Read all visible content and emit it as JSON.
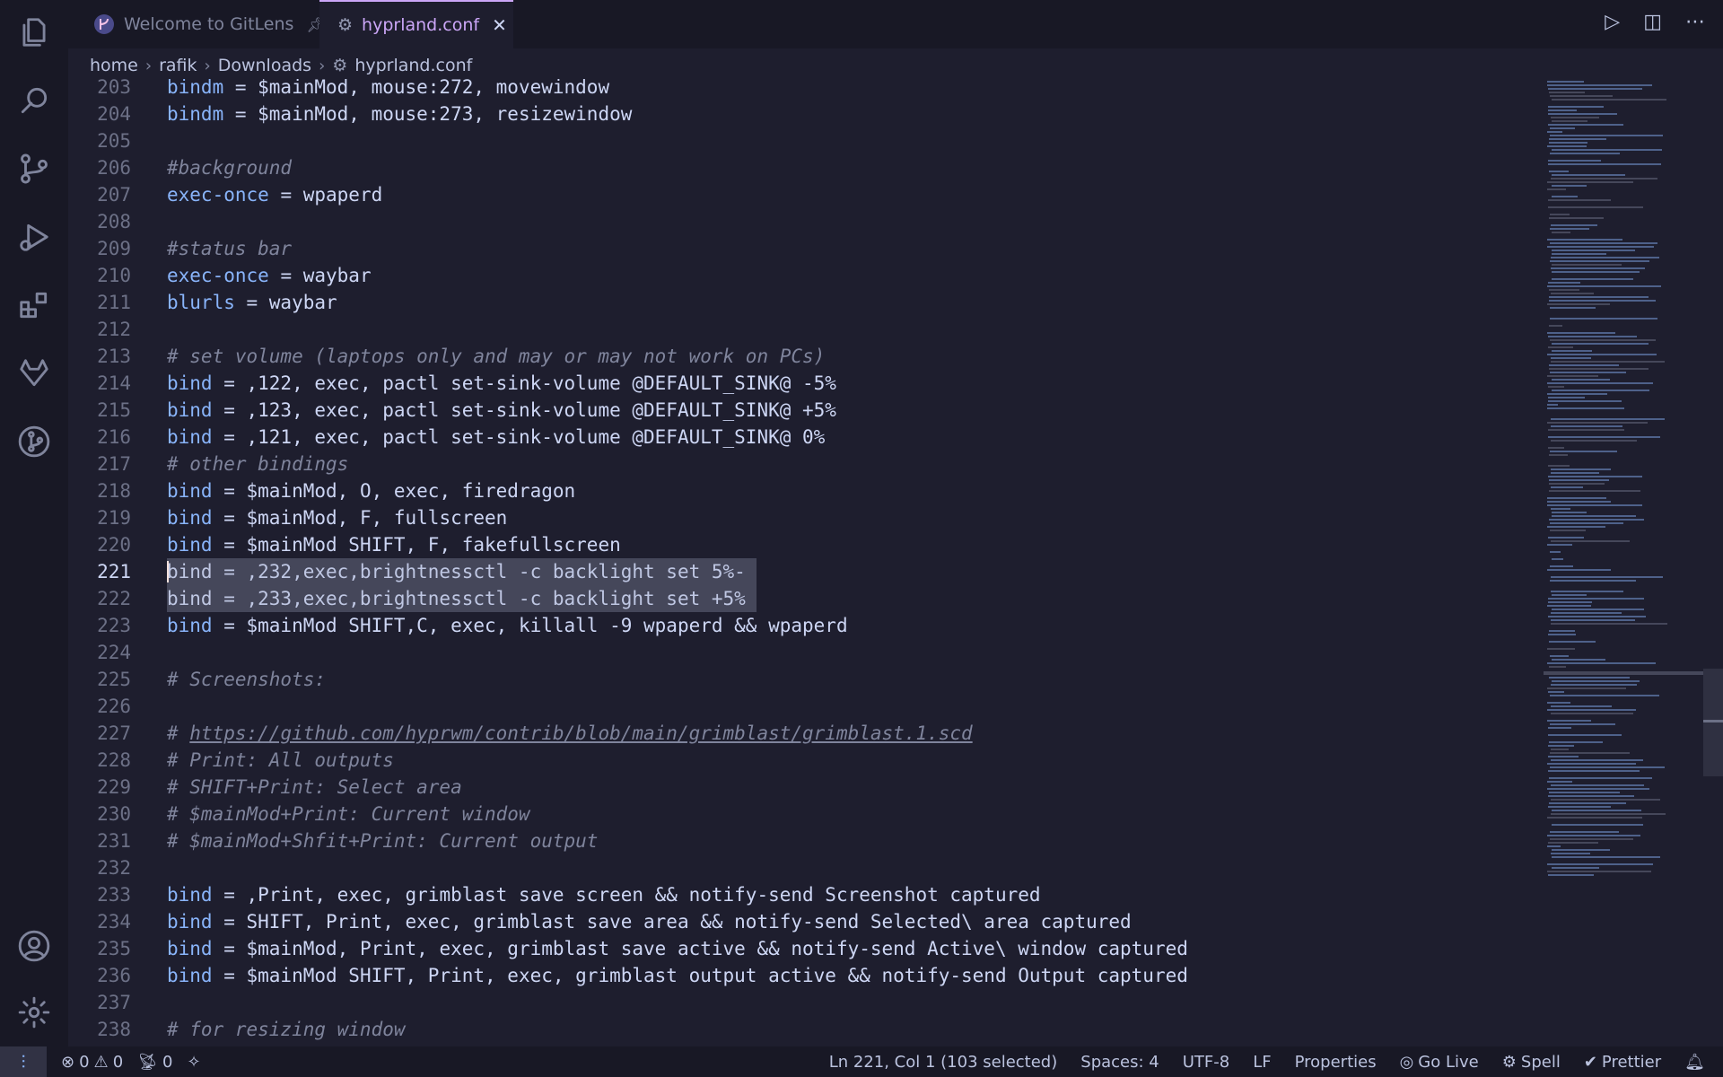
{
  "tabs": [
    {
      "label": "Welcome to GitLens",
      "icon": "gitlens-icon",
      "pinned": true
    },
    {
      "label": "hyprland.conf",
      "icon": "gear-icon",
      "active": true
    }
  ],
  "breadcrumb": [
    "home",
    "rafik",
    "Downloads",
    "hyprland.conf"
  ],
  "editor": {
    "lines": [
      {
        "n": "203",
        "parts": [
          [
            "k",
            "bindm"
          ],
          [
            "t",
            " = $mainMod, mouse:272, movewindow"
          ]
        ]
      },
      {
        "n": "204",
        "parts": [
          [
            "k",
            "bindm"
          ],
          [
            "t",
            " = $mainMod, mouse:273, resizewindow"
          ]
        ]
      },
      {
        "n": "205",
        "parts": []
      },
      {
        "n": "206",
        "parts": [
          [
            "c",
            "#background"
          ]
        ]
      },
      {
        "n": "207",
        "parts": [
          [
            "k",
            "exec-once"
          ],
          [
            "t",
            " = wpaperd"
          ]
        ]
      },
      {
        "n": "208",
        "parts": []
      },
      {
        "n": "209",
        "parts": [
          [
            "c",
            "#status bar"
          ]
        ]
      },
      {
        "n": "210",
        "parts": [
          [
            "k",
            "exec-once"
          ],
          [
            "t",
            " = waybar"
          ]
        ]
      },
      {
        "n": "211",
        "parts": [
          [
            "k",
            "blurls"
          ],
          [
            "t",
            " = waybar"
          ]
        ]
      },
      {
        "n": "212",
        "parts": []
      },
      {
        "n": "213",
        "parts": [
          [
            "c",
            "# set volume (laptops only and may or may not work on PCs)"
          ]
        ]
      },
      {
        "n": "214",
        "parts": [
          [
            "k",
            "bind"
          ],
          [
            "t",
            " = ,122, exec, pactl set-sink-volume @DEFAULT_SINK@ -5%"
          ]
        ]
      },
      {
        "n": "215",
        "parts": [
          [
            "k",
            "bind"
          ],
          [
            "t",
            " = ,123, exec, pactl set-sink-volume @DEFAULT_SINK@ +5%"
          ]
        ]
      },
      {
        "n": "216",
        "parts": [
          [
            "k",
            "bind"
          ],
          [
            "t",
            " = ,121, exec, pactl set-sink-volume @DEFAULT_SINK@ 0%"
          ]
        ]
      },
      {
        "n": "217",
        "parts": [
          [
            "c",
            "# other bindings"
          ]
        ]
      },
      {
        "n": "218",
        "parts": [
          [
            "k",
            "bind"
          ],
          [
            "t",
            " = $mainMod, O, exec, firedragon"
          ]
        ]
      },
      {
        "n": "219",
        "parts": [
          [
            "k",
            "bind"
          ],
          [
            "t",
            " = $mainMod, F, fullscreen"
          ]
        ]
      },
      {
        "n": "220",
        "parts": [
          [
            "k",
            "bind"
          ],
          [
            "t",
            " = $mainMod SHIFT, F, fakefullscreen"
          ]
        ]
      },
      {
        "n": "221",
        "parts": [
          [
            "t",
            "bind = ,232,exec,brightnessctl -c backlight set 5%-"
          ]
        ],
        "selected": true,
        "current": true
      },
      {
        "n": "222",
        "parts": [
          [
            "t",
            "bind = ,233,exec,brightnessctl -c backlight set +5%"
          ]
        ],
        "selected": true
      },
      {
        "n": "223",
        "parts": [
          [
            "k",
            "bind"
          ],
          [
            "t",
            " = $mainMod SHIFT,C, exec, killall -9 wpaperd && wpaperd"
          ]
        ]
      },
      {
        "n": "224",
        "parts": []
      },
      {
        "n": "225",
        "parts": [
          [
            "c",
            "# Screenshots:"
          ]
        ]
      },
      {
        "n": "226",
        "parts": []
      },
      {
        "n": "227",
        "parts": [
          [
            "c",
            "# "
          ],
          [
            "cu",
            "https://github.com/hyprwm/contrib/blob/main/grimblast/grimblast.1.scd"
          ]
        ]
      },
      {
        "n": "228",
        "parts": [
          [
            "c",
            "# Print: All outputs"
          ]
        ]
      },
      {
        "n": "229",
        "parts": [
          [
            "c",
            "# SHIFT+Print: Select area"
          ]
        ]
      },
      {
        "n": "230",
        "parts": [
          [
            "c",
            "# $mainMod+Print: Current window"
          ]
        ]
      },
      {
        "n": "231",
        "parts": [
          [
            "c",
            "# $mainMod+Shfit+Print: Current output"
          ]
        ]
      },
      {
        "n": "232",
        "parts": []
      },
      {
        "n": "233",
        "parts": [
          [
            "k",
            "bind"
          ],
          [
            "t",
            " = ,Print, exec, grimblast save screen && notify-send Screenshot captured"
          ]
        ]
      },
      {
        "n": "234",
        "parts": [
          [
            "k",
            "bind"
          ],
          [
            "t",
            " = SHIFT, Print, exec, grimblast save area && notify-send Selected\\ area captured"
          ]
        ]
      },
      {
        "n": "235",
        "parts": [
          [
            "k",
            "bind"
          ],
          [
            "t",
            " = $mainMod, Print, exec, grimblast save active && notify-send Active\\ window captured"
          ]
        ]
      },
      {
        "n": "236",
        "parts": [
          [
            "k",
            "bind"
          ],
          [
            "t",
            " = $mainMod SHIFT, Print, exec, grimblast output active && notify-send Output captured"
          ]
        ]
      },
      {
        "n": "237",
        "parts": []
      },
      {
        "n": "238",
        "parts": [
          [
            "c",
            "# for resizing window"
          ]
        ]
      }
    ]
  },
  "status": {
    "errors": "0",
    "warnings": "0",
    "ports": "0",
    "cursor": "Ln 221, Col 1 (103 selected)",
    "spaces": "Spaces: 4",
    "encoding": "UTF-8",
    "eol": "LF",
    "language": "Properties",
    "golive": "Go Live",
    "spell": "Spell",
    "prettier": "Prettier"
  },
  "colors": {
    "background": "#1e1e2e",
    "keyword": "#89b4fa",
    "comment": "#7f849c",
    "accent": "#cba6f7"
  }
}
